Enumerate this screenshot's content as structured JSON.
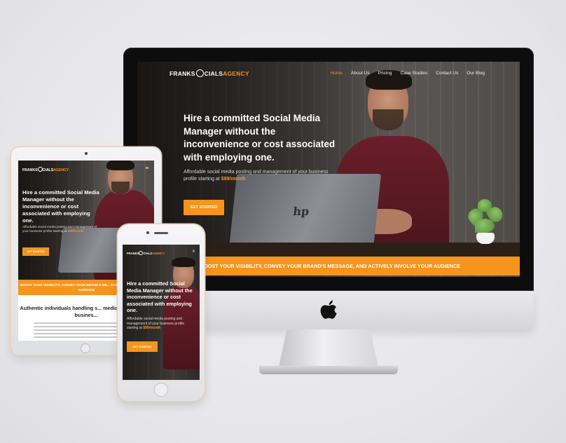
{
  "brand": {
    "logo_left": "FRANKS",
    "logo_mid": "CIALS",
    "logo_accent": "AGENCY",
    "accent_color": "#f7941d"
  },
  "desktop": {
    "nav": {
      "items": [
        {
          "label": "Home",
          "active": true
        },
        {
          "label": "About Us"
        },
        {
          "label": "Pricing"
        },
        {
          "label": "Case Studies"
        },
        {
          "label": "Contact Us"
        },
        {
          "label": "Our Blog"
        }
      ]
    },
    "hero": {
      "title": "Hire a committed Social Media Manager without the inconvenience or cost associated with employing one.",
      "subtitle": "Affordable social media posting and management of your business profile starting at",
      "price": "$99/month",
      "cta": "GET STARTED"
    },
    "banner": "OOST YOUR VISIBILITY, CONVEY YOUR BRAND'S MESSAGE, AND ACTIVELY INVOLVE YOUR AUDIENCE",
    "laptop_logo": "hp"
  },
  "tablet": {
    "menu_icon": "hamburger-icon",
    "hero": {
      "title": "Hire a committed Social Media Manager without the inconvenience or cost associated with employing one.",
      "subtitle": "Affordable social media posting and management of your business profile starting at",
      "price": "$99/month",
      "cta": "GET STARTED"
    },
    "banner": "BOOST YOUR VISIBILITY, CONVEY YOUR BRAND'S ME... ACTIVELY INVOLVE YOUR AUDIENCE",
    "section_heading": "Authentic individuals handling s... media for your small busines..."
  },
  "phone": {
    "menu_icon": "hamburger-icon",
    "hero": {
      "title": "Hire a committed Social Media Manager without the inconvenience or cost associated with employing one.",
      "subtitle": "Affordable social media posting and management of your business profile starting at",
      "price": "$99/month",
      "cta": "GET STARTED"
    }
  }
}
